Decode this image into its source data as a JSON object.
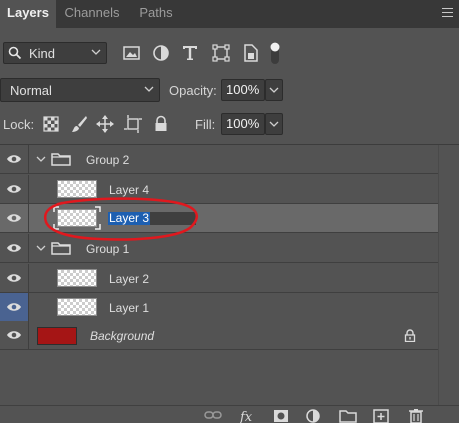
{
  "tabs": [
    {
      "label": "Layers",
      "active": true
    },
    {
      "label": "Channels",
      "active": false
    },
    {
      "label": "Paths",
      "active": false
    }
  ],
  "filter": {
    "kind_label": "Kind"
  },
  "blend": {
    "mode": "Normal",
    "opacity_label": "Opacity:",
    "opacity_value": "100%"
  },
  "lock": {
    "label": "Lock:",
    "fill_label": "Fill:",
    "fill_value": "100%"
  },
  "layers": [
    {
      "name": "Group 2",
      "type": "group",
      "expanded": true
    },
    {
      "name": "Layer 4",
      "type": "layer"
    },
    {
      "name": "Layer 3",
      "type": "layer",
      "selected": true,
      "renaming": true
    },
    {
      "name": "Group 1",
      "type": "group",
      "expanded": true
    },
    {
      "name": "Layer 2",
      "type": "layer"
    },
    {
      "name": "Layer 1",
      "type": "layer"
    },
    {
      "name": "Background",
      "type": "background",
      "locked": true,
      "swatch_color": "#a51515"
    }
  ],
  "icons": {
    "filters": [
      "image-filter-icon",
      "adjustment-filter-icon",
      "type-filter-icon",
      "shape-filter-icon",
      "smart-object-filter-icon",
      "filter-toggle-icon"
    ],
    "locks": [
      "lock-transparency-icon",
      "lock-image-pixels-icon",
      "lock-position-icon",
      "lock-artboard-icon",
      "lock-all-icon"
    ],
    "bottom": [
      "link-layers-icon",
      "layer-style-icon",
      "layer-mask-icon",
      "adjustment-layer-icon",
      "new-group-icon",
      "new-layer-icon",
      "delete-layer-icon"
    ]
  },
  "colors": {
    "selection": "#1d5fb1",
    "annotation": "#e0181e",
    "eye_highlight": "#4a6391"
  }
}
